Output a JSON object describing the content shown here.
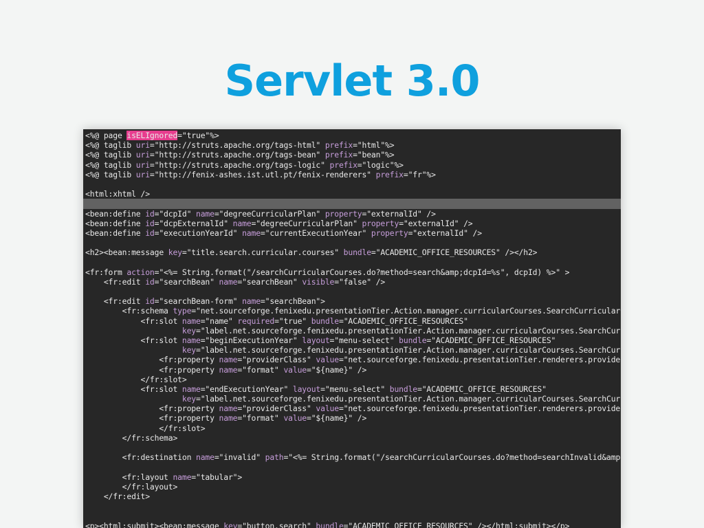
{
  "slide": {
    "title": "Servlet 3.0"
  },
  "colors": {
    "background": "#f3f5f4",
    "title": "#0fa0de",
    "editor_background": "#272727",
    "current_line": "#626262",
    "search_match": "#e73d8e",
    "tag": "#e9e9e9",
    "attribute": "#c79edb",
    "string": "#e9e9e9"
  },
  "code": {
    "highlighted_line": 7,
    "lines": [
      [
        [
          "<%@ page ",
          "t"
        ],
        [
          "isELIgnored",
          "m"
        ],
        [
          "=\"true\"%>",
          "t"
        ]
      ],
      [
        [
          "<%@ taglib ",
          "t"
        ],
        [
          "uri",
          "a"
        ],
        [
          "=\"http://struts.apache.org/tags-html\" ",
          "s"
        ],
        [
          "prefix",
          "a"
        ],
        [
          "=\"html\"%>",
          "s"
        ]
      ],
      [
        [
          "<%@ taglib ",
          "t"
        ],
        [
          "uri",
          "a"
        ],
        [
          "=\"http://struts.apache.org/tags-bean\" ",
          "s"
        ],
        [
          "prefix",
          "a"
        ],
        [
          "=\"bean\"%>",
          "s"
        ]
      ],
      [
        [
          "<%@ taglib ",
          "t"
        ],
        [
          "uri",
          "a"
        ],
        [
          "=\"http://struts.apache.org/tags-logic\" ",
          "s"
        ],
        [
          "prefix",
          "a"
        ],
        [
          "=\"logic\"%>",
          "s"
        ]
      ],
      [
        [
          "<%@ taglib ",
          "t"
        ],
        [
          "uri",
          "a"
        ],
        [
          "=\"http://fenix-ashes.ist.utl.pt/fenix-renderers\" ",
          "s"
        ],
        [
          "prefix",
          "a"
        ],
        [
          "=\"fr\"%>",
          "s"
        ]
      ],
      [],
      [
        [
          "<html:xhtml />",
          "t"
        ]
      ],
      [],
      [
        [
          "<bean:define ",
          "t"
        ],
        [
          "id",
          "a"
        ],
        [
          "=\"dcpId\" ",
          "s"
        ],
        [
          "name",
          "a"
        ],
        [
          "=\"degreeCurricularPlan\" ",
          "s"
        ],
        [
          "property",
          "a"
        ],
        [
          "=\"externalId\" />",
          "s"
        ]
      ],
      [
        [
          "<bean:define ",
          "t"
        ],
        [
          "id",
          "a"
        ],
        [
          "=\"dcpExternalId\" ",
          "s"
        ],
        [
          "name",
          "a"
        ],
        [
          "=\"degreeCurricularPlan\" ",
          "s"
        ],
        [
          "property",
          "a"
        ],
        [
          "=\"externalId\" />",
          "s"
        ]
      ],
      [
        [
          "<bean:define ",
          "t"
        ],
        [
          "id",
          "a"
        ],
        [
          "=\"executionYearId\" ",
          "s"
        ],
        [
          "name",
          "a"
        ],
        [
          "=\"currentExecutionYear\" ",
          "s"
        ],
        [
          "property",
          "a"
        ],
        [
          "=\"externalId\" />",
          "s"
        ]
      ],
      [],
      [
        [
          "<h2><bean:message ",
          "t"
        ],
        [
          "key",
          "a"
        ],
        [
          "=\"title.search.curricular.courses\" ",
          "s"
        ],
        [
          "bundle",
          "a"
        ],
        [
          "=\"ACADEMIC_OFFICE_RESOURCES\" /></h2>",
          "s"
        ]
      ],
      [],
      [
        [
          "<fr:form ",
          "t"
        ],
        [
          "action",
          "a"
        ],
        [
          "=\"<%= String.format(\"/searchCurricularCourses.do?method=search&amp;dcpId=%s\", dcpId) %>\" >",
          "s"
        ]
      ],
      [
        [
          "    <fr:edit ",
          "t"
        ],
        [
          "id",
          "a"
        ],
        [
          "=\"searchBean\" ",
          "s"
        ],
        [
          "name",
          "a"
        ],
        [
          "=\"searchBean\" ",
          "s"
        ],
        [
          "visible",
          "a"
        ],
        [
          "=\"false\" />",
          "s"
        ]
      ],
      [],
      [
        [
          "    <fr:edit ",
          "t"
        ],
        [
          "id",
          "a"
        ],
        [
          "=\"searchBean-form\" ",
          "s"
        ],
        [
          "name",
          "a"
        ],
        [
          "=\"searchBean\">",
          "s"
        ]
      ],
      [
        [
          "        <fr:schema ",
          "t"
        ],
        [
          "type",
          "a"
        ],
        [
          "=\"net.sourceforge.fenixedu.presentationTier.Action.manager.curricularCourses.SearchCurricularC",
          "s"
        ]
      ],
      [
        [
          "            <fr:slot ",
          "t"
        ],
        [
          "name",
          "a"
        ],
        [
          "=\"name\" ",
          "s"
        ],
        [
          "required",
          "a"
        ],
        [
          "=\"true\" ",
          "s"
        ],
        [
          "bundle",
          "a"
        ],
        [
          "=\"ACADEMIC_OFFICE_RESOURCES\"",
          "s"
        ]
      ],
      [
        [
          "                     ",
          "t"
        ],
        [
          "key",
          "a"
        ],
        [
          "=\"label.net.sourceforge.fenixedu.presentationTier.Action.manager.curricularCourses.SearchCurr",
          "s"
        ]
      ],
      [
        [
          "            <fr:slot ",
          "t"
        ],
        [
          "name",
          "a"
        ],
        [
          "=\"beginExecutionYear\" ",
          "s"
        ],
        [
          "layout",
          "a"
        ],
        [
          "=\"menu-select\" ",
          "s"
        ],
        [
          "bundle",
          "a"
        ],
        [
          "=\"ACADEMIC_OFFICE_RESOURCES\"",
          "s"
        ]
      ],
      [
        [
          "                     ",
          "t"
        ],
        [
          "key",
          "a"
        ],
        [
          "=\"label.net.sourceforge.fenixedu.presentationTier.Action.manager.curricularCourses.SearchCurr",
          "s"
        ]
      ],
      [
        [
          "                <fr:property ",
          "t"
        ],
        [
          "name",
          "a"
        ],
        [
          "=\"providerClass\" ",
          "s"
        ],
        [
          "value",
          "a"
        ],
        [
          "=\"net.sourceforge.fenixedu.presentationTier.renderers.provider",
          "s"
        ]
      ],
      [
        [
          "                <fr:property ",
          "t"
        ],
        [
          "name",
          "a"
        ],
        [
          "=\"format\" ",
          "s"
        ],
        [
          "value",
          "a"
        ],
        [
          "=\"${name}\" />",
          "s"
        ]
      ],
      [
        [
          "            </fr:slot>",
          "t"
        ]
      ],
      [
        [
          "            <fr:slot ",
          "t"
        ],
        [
          "name",
          "a"
        ],
        [
          "=\"endExecutionYear\" ",
          "s"
        ],
        [
          "layout",
          "a"
        ],
        [
          "=\"menu-select\" ",
          "s"
        ],
        [
          "bundle",
          "a"
        ],
        [
          "=\"ACADEMIC_OFFICE_RESOURCES\"",
          "s"
        ]
      ],
      [
        [
          "                     ",
          "t"
        ],
        [
          "key",
          "a"
        ],
        [
          "=\"label.net.sourceforge.fenixedu.presentationTier.Action.manager.curricularCourses.SearchCurr",
          "s"
        ]
      ],
      [
        [
          "                <fr:property ",
          "t"
        ],
        [
          "name",
          "a"
        ],
        [
          "=\"providerClass\" ",
          "s"
        ],
        [
          "value",
          "a"
        ],
        [
          "=\"net.sourceforge.fenixedu.presentationTier.renderers.provider",
          "s"
        ]
      ],
      [
        [
          "                <fr:property ",
          "t"
        ],
        [
          "name",
          "a"
        ],
        [
          "=\"format\" ",
          "s"
        ],
        [
          "value",
          "a"
        ],
        [
          "=\"${name}\" />",
          "s"
        ]
      ],
      [
        [
          "                </fr:slot>",
          "t"
        ]
      ],
      [
        [
          "        </fr:schema>",
          "t"
        ]
      ],
      [],
      [
        [
          "        <fr:destination ",
          "t"
        ],
        [
          "name",
          "a"
        ],
        [
          "=\"invalid\" ",
          "s"
        ],
        [
          "path",
          "a"
        ],
        [
          "=\"<%= String.format(\"/searchCurricularCourses.do?method=searchInvalid&amp;",
          "s"
        ]
      ],
      [],
      [
        [
          "        <fr:layout ",
          "t"
        ],
        [
          "name",
          "a"
        ],
        [
          "=\"tabular\">",
          "s"
        ]
      ],
      [
        [
          "        </fr:layout>",
          "t"
        ]
      ],
      [
        [
          "    </fr:edit>",
          "t"
        ]
      ],
      [],
      [],
      [
        [
          "<p><html:submit><bean:message ",
          "t"
        ],
        [
          "key",
          "a"
        ],
        [
          "=\"button.search\" ",
          "s"
        ],
        [
          "bundle",
          "a"
        ],
        [
          "=\"ACADEMIC_OFFICE_RESOURCES\" /></html:submit></p>",
          "s"
        ]
      ]
    ]
  }
}
